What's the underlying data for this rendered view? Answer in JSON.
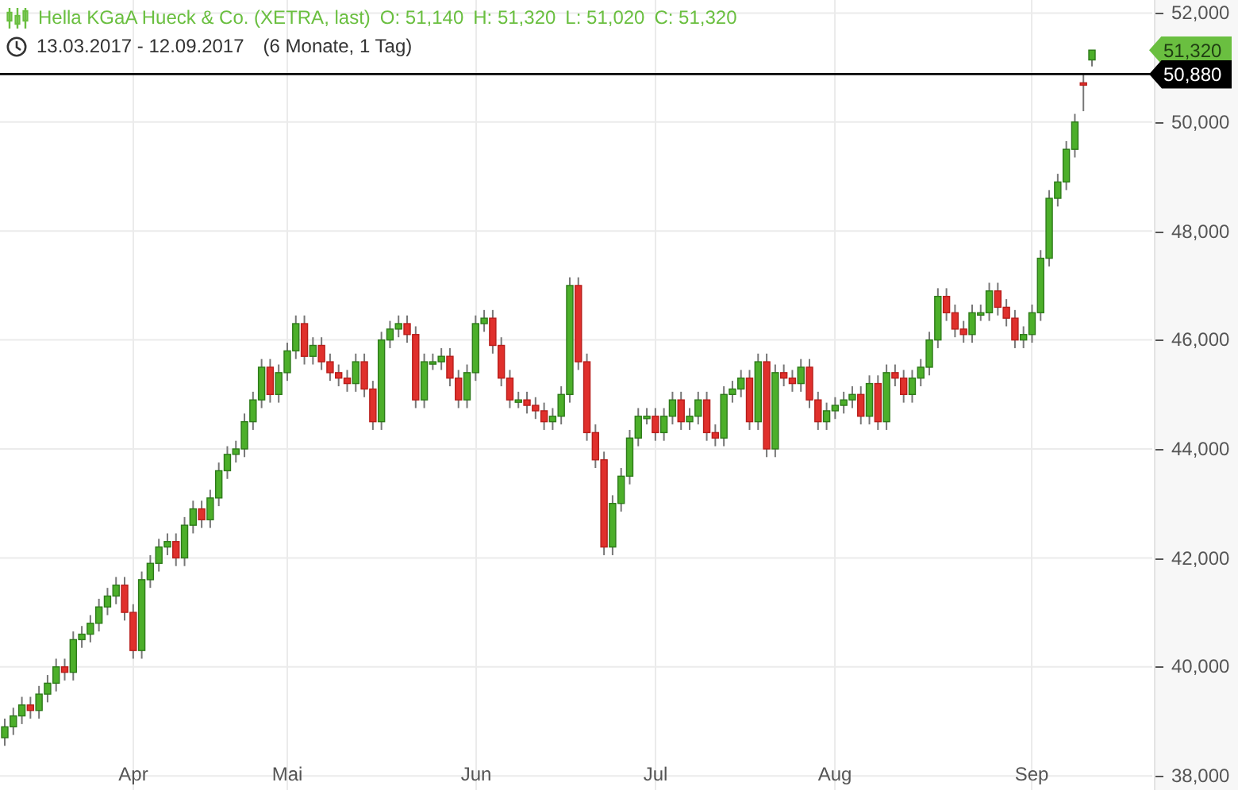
{
  "header": {
    "title": "Hella KGaA Hueck & Co. (XETRA, last)",
    "quote": [
      "O: 51,140",
      "H: 51,320",
      "L: 51,020",
      "C: 51,320"
    ],
    "date_range": "13.03.2017 - 12.09.2017",
    "period": "(6 Monate, 1 Tag)"
  },
  "x_axis": {
    "labels": [
      "Apr",
      "Mai",
      "Jun",
      "Jul",
      "Aug",
      "Sep"
    ]
  },
  "chart_data": {
    "type": "candlestick",
    "ylim": [
      37740,
      52240
    ],
    "grid": true,
    "ref_lines": [
      {
        "axis": "y",
        "value": 50880,
        "label": "50,880"
      }
    ],
    "yticks": [
      {
        "value": 52000,
        "label": "52,000"
      },
      {
        "value": 50000,
        "label": "50,000"
      },
      {
        "value": 48000,
        "label": "48,000"
      },
      {
        "value": 46000,
        "label": "46,000"
      },
      {
        "value": 44000,
        "label": "44,000"
      },
      {
        "value": 42000,
        "label": "42,000"
      },
      {
        "value": 40000,
        "label": "40,000"
      },
      {
        "value": 38000,
        "label": "38,000"
      }
    ],
    "ohlc": [
      [
        38700,
        39050,
        38550,
        38900
      ],
      [
        38900,
        39250,
        38750,
        39100
      ],
      [
        39100,
        39450,
        38950,
        39300
      ],
      [
        39300,
        39450,
        39050,
        39200
      ],
      [
        39200,
        39650,
        39050,
        39500
      ],
      [
        39500,
        39850,
        39350,
        39700
      ],
      [
        39700,
        40150,
        39550,
        40000
      ],
      [
        40000,
        40150,
        39750,
        39900
      ],
      [
        39900,
        40650,
        39750,
        40500
      ],
      [
        40500,
        40750,
        40350,
        40600
      ],
      [
        40600,
        40950,
        40450,
        40800
      ],
      [
        40800,
        41250,
        40650,
        41100
      ],
      [
        41100,
        41450,
        40950,
        41300
      ],
      [
        41300,
        41650,
        41150,
        41500
      ],
      [
        41500,
        41650,
        40850,
        41000
      ],
      [
        41000,
        41150,
        40150,
        40300
      ],
      [
        40300,
        41750,
        40150,
        41600
      ],
      [
        41600,
        42050,
        41450,
        41900
      ],
      [
        41900,
        42350,
        41750,
        42200
      ],
      [
        42200,
        42450,
        42050,
        42300
      ],
      [
        42300,
        42450,
        41850,
        42000
      ],
      [
        42000,
        42750,
        41850,
        42600
      ],
      [
        42600,
        43050,
        42450,
        42900
      ],
      [
        42900,
        43050,
        42550,
        42700
      ],
      [
        42700,
        43250,
        42550,
        43100
      ],
      [
        43100,
        43750,
        42950,
        43600
      ],
      [
        43600,
        44050,
        43450,
        43900
      ],
      [
        43900,
        44150,
        43750,
        44000
      ],
      [
        44000,
        44650,
        43850,
        44500
      ],
      [
        44500,
        45050,
        44350,
        44900
      ],
      [
        44900,
        45650,
        44750,
        45500
      ],
      [
        45500,
        45650,
        44850,
        45000
      ],
      [
        45000,
        45550,
        44850,
        45400
      ],
      [
        45400,
        45950,
        45250,
        45800
      ],
      [
        45800,
        46450,
        45650,
        46300
      ],
      [
        46300,
        46450,
        45550,
        45700
      ],
      [
        45700,
        46050,
        45550,
        45900
      ],
      [
        45900,
        46050,
        45450,
        45600
      ],
      [
        45600,
        45750,
        45250,
        45400
      ],
      [
        45400,
        45550,
        45150,
        45300
      ],
      [
        45300,
        45450,
        45050,
        45200
      ],
      [
        45200,
        45750,
        45050,
        45600
      ],
      [
        45600,
        45750,
        44950,
        45100
      ],
      [
        45100,
        45250,
        44350,
        44500
      ],
      [
        44500,
        46150,
        44350,
        46000
      ],
      [
        46000,
        46350,
        45850,
        46200
      ],
      [
        46200,
        46450,
        46050,
        46300
      ],
      [
        46300,
        46450,
        45950,
        46100
      ],
      [
        46100,
        46250,
        44750,
        44900
      ],
      [
        44900,
        45750,
        44750,
        45600
      ],
      [
        45600,
        45750,
        45450,
        45600
      ],
      [
        45600,
        45850,
        45450,
        45700
      ],
      [
        45700,
        45850,
        45150,
        45300
      ],
      [
        45300,
        45450,
        44750,
        44900
      ],
      [
        44900,
        45550,
        44750,
        45400
      ],
      [
        45400,
        46450,
        45250,
        46300
      ],
      [
        46300,
        46550,
        46150,
        46400
      ],
      [
        46400,
        46550,
        45750,
        45900
      ],
      [
        45900,
        46050,
        45150,
        45300
      ],
      [
        45300,
        45450,
        44750,
        44900
      ],
      [
        44900,
        45050,
        44750,
        44900
      ],
      [
        44900,
        45050,
        44650,
        44800
      ],
      [
        44800,
        44950,
        44550,
        44700
      ],
      [
        44700,
        44850,
        44350,
        44500
      ],
      [
        44500,
        44750,
        44350,
        44600
      ],
      [
        44600,
        45150,
        44450,
        45000
      ],
      [
        45000,
        47150,
        44850,
        47000
      ],
      [
        47000,
        47150,
        45450,
        45600
      ],
      [
        45600,
        45750,
        44150,
        44300
      ],
      [
        44300,
        44450,
        43650,
        43800
      ],
      [
        43800,
        43950,
        42050,
        42200
      ],
      [
        42200,
        43150,
        42050,
        43000
      ],
      [
        43000,
        43650,
        42850,
        43500
      ],
      [
        43500,
        44350,
        43350,
        44200
      ],
      [
        44200,
        44750,
        44050,
        44600
      ],
      [
        44600,
        44750,
        44450,
        44600
      ],
      [
        44600,
        44750,
        44150,
        44300
      ],
      [
        44300,
        44750,
        44150,
        44600
      ],
      [
        44600,
        45050,
        44450,
        44900
      ],
      [
        44900,
        45050,
        44350,
        44500
      ],
      [
        44500,
        44750,
        44350,
        44600
      ],
      [
        44600,
        45050,
        44450,
        44900
      ],
      [
        44900,
        45050,
        44150,
        44300
      ],
      [
        44300,
        44450,
        44050,
        44200
      ],
      [
        44200,
        45150,
        44050,
        45000
      ],
      [
        45000,
        45250,
        44850,
        45100
      ],
      [
        45100,
        45450,
        44950,
        45300
      ],
      [
        45300,
        45450,
        44350,
        44500
      ],
      [
        44500,
        45750,
        44350,
        45600
      ],
      [
        45600,
        45750,
        43850,
        44000
      ],
      [
        44000,
        45550,
        43850,
        45400
      ],
      [
        45400,
        45550,
        45150,
        45300
      ],
      [
        45300,
        45450,
        45050,
        45200
      ],
      [
        45200,
        45650,
        45050,
        45500
      ],
      [
        45500,
        45650,
        44750,
        44900
      ],
      [
        44900,
        45050,
        44350,
        44500
      ],
      [
        44500,
        44850,
        44350,
        44700
      ],
      [
        44700,
        44950,
        44550,
        44800
      ],
      [
        44800,
        45050,
        44650,
        44900
      ],
      [
        44900,
        45150,
        44750,
        45000
      ],
      [
        45000,
        45150,
        44450,
        44600
      ],
      [
        44600,
        45350,
        44450,
        45200
      ],
      [
        45200,
        45350,
        44350,
        44500
      ],
      [
        44500,
        45550,
        44350,
        45400
      ],
      [
        45400,
        45550,
        45150,
        45300
      ],
      [
        45300,
        45450,
        44850,
        45000
      ],
      [
        45000,
        45450,
        44850,
        45300
      ],
      [
        45300,
        45650,
        45150,
        45500
      ],
      [
        45500,
        46150,
        45350,
        46000
      ],
      [
        46000,
        46950,
        45850,
        46800
      ],
      [
        46800,
        46950,
        46350,
        46500
      ],
      [
        46500,
        46650,
        46050,
        46200
      ],
      [
        46200,
        46350,
        45950,
        46100
      ],
      [
        46100,
        46650,
        45950,
        46500
      ],
      [
        46500,
        46650,
        46350,
        46500
      ],
      [
        46500,
        47050,
        46350,
        46900
      ],
      [
        46900,
        47050,
        46450,
        46600
      ],
      [
        46600,
        46750,
        46250,
        46400
      ],
      [
        46400,
        46550,
        45850,
        46000
      ],
      [
        46000,
        46250,
        45850,
        46100
      ],
      [
        46100,
        46650,
        45950,
        46500
      ],
      [
        46500,
        47650,
        46350,
        47500
      ],
      [
        47500,
        48750,
        47350,
        48600
      ],
      [
        48600,
        49050,
        48450,
        48900
      ],
      [
        48900,
        49650,
        48750,
        49500
      ],
      [
        49500,
        50150,
        49350,
        50000
      ],
      [
        50720,
        50880,
        50200,
        50680
      ],
      [
        51140,
        51320,
        51020,
        51320
      ]
    ]
  },
  "price_tags": [
    {
      "kind": "last",
      "label": "51,320"
    }
  ]
}
